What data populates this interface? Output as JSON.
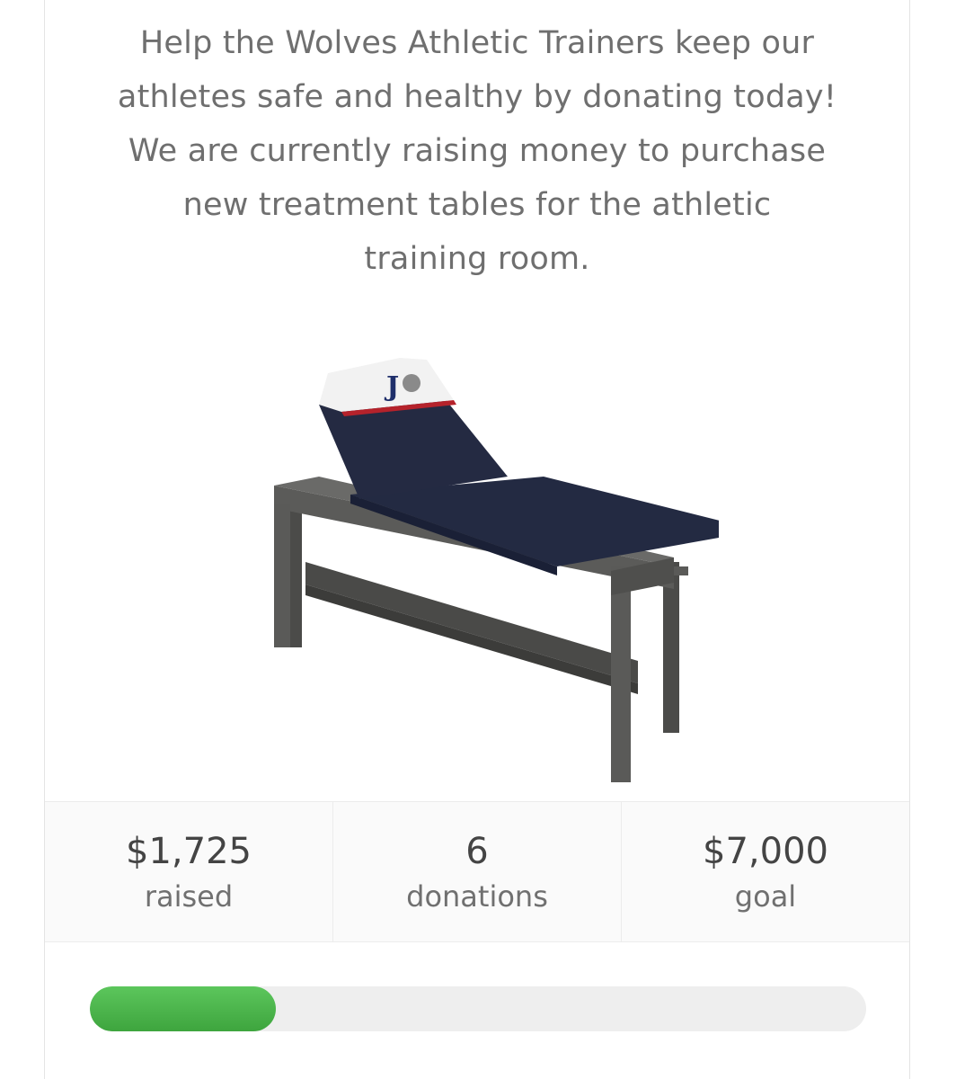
{
  "campaign": {
    "description_lines": [
      "Help the Wolves Athletic Trainers keep our",
      "athletes safe and healthy by donating today!",
      "We are currently raising money to purchase",
      "new treatment tables for the athletic",
      "training room."
    ],
    "image_icon": "treatment-table-image",
    "logo_letter": "J"
  },
  "stats": {
    "raised": {
      "value": "$1,725",
      "label": "raised"
    },
    "donations": {
      "value": "6",
      "label": "donations"
    },
    "goal": {
      "value": "$7,000",
      "label": "goal"
    }
  },
  "progress": {
    "fraction": 0.24,
    "color": "#4cb54c",
    "track_color": "#eeeeee"
  },
  "colors": {
    "text": "#6f6f6f",
    "table_pad": "#242a42",
    "table_frame": "#555553",
    "headrest": "#f2f2f2",
    "stripe": "#b5222b"
  }
}
